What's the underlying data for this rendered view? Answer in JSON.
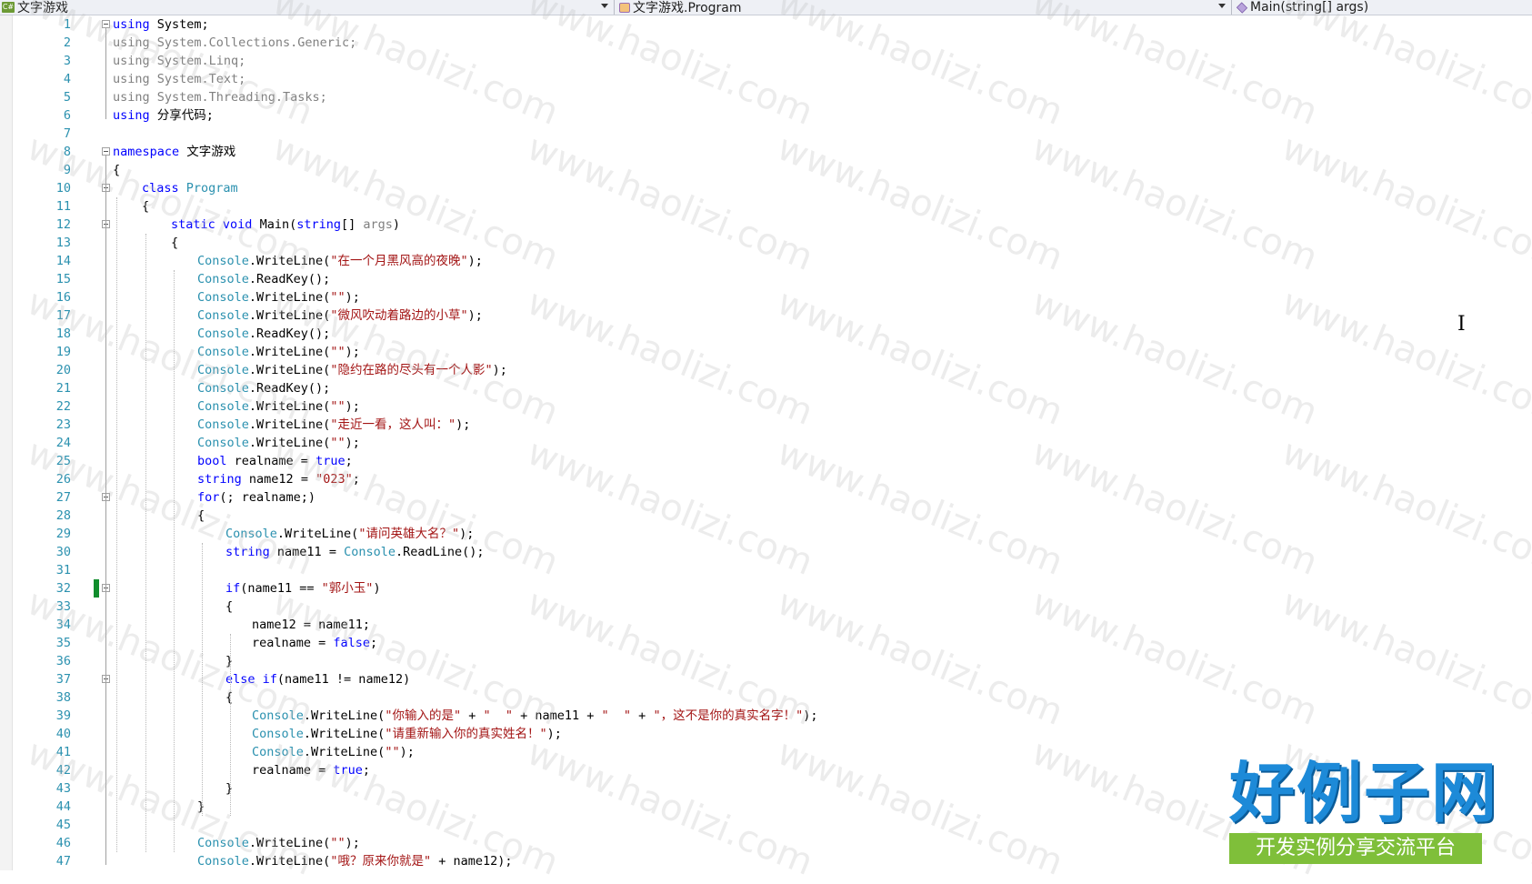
{
  "nav": {
    "project": "文字游戏",
    "type": "文字游戏.Program",
    "member": "Main(string[] args)"
  },
  "watermark": "www.haolizi.com",
  "logo": {
    "title": "好例子网",
    "subtitle": "开发实例分享交流平台"
  },
  "code_lines": [
    {
      "n": "1",
      "indent": 0,
      "tokens": [
        [
          "kw",
          "using"
        ],
        [
          "",
          "System;"
        ]
      ]
    },
    {
      "n": "2",
      "indent": 0,
      "tokens": [
        [
          "gray",
          "using"
        ],
        [
          "gray",
          "System.Collections.Generic;"
        ]
      ]
    },
    {
      "n": "3",
      "indent": 0,
      "tokens": [
        [
          "gray",
          "using"
        ],
        [
          "gray",
          "System.Linq;"
        ]
      ]
    },
    {
      "n": "4",
      "indent": 0,
      "tokens": [
        [
          "gray",
          "using"
        ],
        [
          "gray",
          "System.Text;"
        ]
      ]
    },
    {
      "n": "5",
      "indent": 0,
      "tokens": [
        [
          "gray",
          "using"
        ],
        [
          "gray",
          "System.Threading.Tasks;"
        ]
      ]
    },
    {
      "n": "6",
      "indent": 0,
      "tokens": [
        [
          "kw",
          "using"
        ],
        [
          "",
          "分享代码;"
        ]
      ]
    },
    {
      "n": "7",
      "indent": 0,
      "tokens": []
    },
    {
      "n": "8",
      "indent": 0,
      "tokens": [
        [
          "kw",
          "namespace"
        ],
        [
          "",
          "文字游戏"
        ]
      ]
    },
    {
      "n": "9",
      "indent": 0,
      "tokens": [
        [
          "",
          "{"
        ]
      ]
    },
    {
      "n": "10",
      "indent": 1,
      "tokens": [
        [
          "kw",
          "class"
        ],
        [
          "tp",
          "Program"
        ]
      ]
    },
    {
      "n": "11",
      "indent": 1,
      "tokens": [
        [
          "",
          "{"
        ]
      ]
    },
    {
      "n": "12",
      "indent": 2,
      "tokens": [
        [
          "kw",
          "static"
        ],
        [
          "kw",
          "void"
        ],
        [
          "",
          "Main("
        ],
        [
          "kw",
          "string"
        ],
        [
          "",
          "[] "
        ],
        [
          "gray",
          "args"
        ],
        [
          "",
          ")"
        ]
      ]
    },
    {
      "n": "13",
      "indent": 2,
      "tokens": [
        [
          "",
          "{"
        ]
      ]
    },
    {
      "n": "14",
      "indent": 3,
      "tokens": [
        [
          "tp",
          "Console"
        ],
        [
          "",
          ".WriteLine("
        ],
        [
          "str",
          "\"在一个月黑风高的夜晚\""
        ],
        [
          "",
          ");"
        ]
      ]
    },
    {
      "n": "15",
      "indent": 3,
      "tokens": [
        [
          "tp",
          "Console"
        ],
        [
          "",
          ".ReadKey();"
        ]
      ]
    },
    {
      "n": "16",
      "indent": 3,
      "tokens": [
        [
          "tp",
          "Console"
        ],
        [
          "",
          ".WriteLine("
        ],
        [
          "str",
          "\"\""
        ],
        [
          "",
          ");"
        ]
      ]
    },
    {
      "n": "17",
      "indent": 3,
      "tokens": [
        [
          "tp",
          "Console"
        ],
        [
          "",
          ".WriteLine("
        ],
        [
          "str",
          "\"微风吹动着路边的小草\""
        ],
        [
          "",
          ");"
        ]
      ]
    },
    {
      "n": "18",
      "indent": 3,
      "tokens": [
        [
          "tp",
          "Console"
        ],
        [
          "",
          ".ReadKey();"
        ]
      ]
    },
    {
      "n": "19",
      "indent": 3,
      "tokens": [
        [
          "tp",
          "Console"
        ],
        [
          "",
          ".WriteLine("
        ],
        [
          "str",
          "\"\""
        ],
        [
          "",
          ");"
        ]
      ]
    },
    {
      "n": "20",
      "indent": 3,
      "tokens": [
        [
          "tp",
          "Console"
        ],
        [
          "",
          ".WriteLine("
        ],
        [
          "str",
          "\"隐约在路的尽头有一个人影\""
        ],
        [
          "",
          ");"
        ]
      ]
    },
    {
      "n": "21",
      "indent": 3,
      "tokens": [
        [
          "tp",
          "Console"
        ],
        [
          "",
          ".ReadKey();"
        ]
      ]
    },
    {
      "n": "22",
      "indent": 3,
      "tokens": [
        [
          "tp",
          "Console"
        ],
        [
          "",
          ".WriteLine("
        ],
        [
          "str",
          "\"\""
        ],
        [
          "",
          ");"
        ]
      ]
    },
    {
      "n": "23",
      "indent": 3,
      "tokens": [
        [
          "tp",
          "Console"
        ],
        [
          "",
          ".WriteLine("
        ],
        [
          "str",
          "\"走近一看，这人叫：\""
        ],
        [
          "",
          ");"
        ]
      ]
    },
    {
      "n": "24",
      "indent": 3,
      "tokens": [
        [
          "tp",
          "Console"
        ],
        [
          "",
          ".WriteLine("
        ],
        [
          "str",
          "\"\""
        ],
        [
          "",
          ");"
        ]
      ]
    },
    {
      "n": "25",
      "indent": 3,
      "tokens": [
        [
          "kw",
          "bool"
        ],
        [
          "",
          "realname = "
        ],
        [
          "kw",
          "true"
        ],
        [
          "",
          ";"
        ]
      ]
    },
    {
      "n": "26",
      "indent": 3,
      "tokens": [
        [
          "kw",
          "string"
        ],
        [
          "",
          "name12 = "
        ],
        [
          "str",
          "\"023\""
        ],
        [
          "",
          ";"
        ]
      ]
    },
    {
      "n": "27",
      "indent": 3,
      "tokens": [
        [
          "kw",
          "for"
        ],
        [
          "",
          "(; realname;)"
        ]
      ]
    },
    {
      "n": "28",
      "indent": 3,
      "tokens": [
        [
          "",
          "{"
        ]
      ]
    },
    {
      "n": "29",
      "indent": 4,
      "tokens": [
        [
          "tp",
          "Console"
        ],
        [
          "",
          ".WriteLine("
        ],
        [
          "str",
          "\"请问英雄大名？\""
        ],
        [
          "",
          ");"
        ]
      ]
    },
    {
      "n": "30",
      "indent": 4,
      "tokens": [
        [
          "kw",
          "string"
        ],
        [
          "",
          "name11 = "
        ],
        [
          "tp",
          "Console"
        ],
        [
          "",
          ".ReadLine();"
        ]
      ]
    },
    {
      "n": "31",
      "indent": 4,
      "tokens": []
    },
    {
      "n": "32",
      "indent": 4,
      "tokens": [
        [
          "kw",
          "if"
        ],
        [
          "",
          "(name11 == "
        ],
        [
          "str",
          "\"郭小玉\""
        ],
        [
          "",
          ")"
        ]
      ]
    },
    {
      "n": "33",
      "indent": 4,
      "tokens": [
        [
          "",
          "{"
        ]
      ]
    },
    {
      "n": "34",
      "indent": 5,
      "tokens": [
        [
          "",
          "name12 = name11;"
        ]
      ]
    },
    {
      "n": "35",
      "indent": 5,
      "tokens": [
        [
          "",
          "realname = "
        ],
        [
          "kw",
          "false"
        ],
        [
          "",
          ";"
        ]
      ]
    },
    {
      "n": "36",
      "indent": 4,
      "tokens": [
        [
          "",
          "}"
        ]
      ]
    },
    {
      "n": "37",
      "indent": 4,
      "tokens": [
        [
          "kw",
          "else if"
        ],
        [
          "",
          "(name11 != name12)"
        ]
      ]
    },
    {
      "n": "38",
      "indent": 4,
      "tokens": [
        [
          "",
          "{"
        ]
      ]
    },
    {
      "n": "39",
      "indent": 5,
      "tokens": [
        [
          "tp",
          "Console"
        ],
        [
          "",
          ".WriteLine("
        ],
        [
          "str",
          "\"你输入的是\""
        ],
        [
          "",
          " + "
        ],
        [
          "str",
          "\"  \""
        ],
        [
          "",
          " + name11 + "
        ],
        [
          "str",
          "\"  \""
        ],
        [
          "",
          " + "
        ],
        [
          "str",
          "\"，这不是你的真实名字！\""
        ],
        [
          "",
          ");"
        ]
      ]
    },
    {
      "n": "40",
      "indent": 5,
      "tokens": [
        [
          "tp",
          "Console"
        ],
        [
          "",
          ".WriteLine("
        ],
        [
          "str",
          "\"请重新输入你的真实姓名！\""
        ],
        [
          "",
          ");"
        ]
      ]
    },
    {
      "n": "41",
      "indent": 5,
      "tokens": [
        [
          "tp",
          "Console"
        ],
        [
          "",
          ".WriteLine("
        ],
        [
          "str",
          "\"\""
        ],
        [
          "",
          ");"
        ]
      ]
    },
    {
      "n": "42",
      "indent": 5,
      "tokens": [
        [
          "",
          "realname = "
        ],
        [
          "kw",
          "true"
        ],
        [
          "",
          ";"
        ]
      ]
    },
    {
      "n": "43",
      "indent": 4,
      "tokens": [
        [
          "",
          "}"
        ]
      ]
    },
    {
      "n": "44",
      "indent": 3,
      "tokens": [
        [
          "",
          "}"
        ]
      ]
    },
    {
      "n": "45",
      "indent": 3,
      "tokens": []
    },
    {
      "n": "46",
      "indent": 3,
      "tokens": [
        [
          "tp",
          "Console"
        ],
        [
          "",
          ".WriteLine("
        ],
        [
          "str",
          "\"\""
        ],
        [
          "",
          ");"
        ]
      ]
    },
    {
      "n": "47",
      "indent": 3,
      "tokens": [
        [
          "tp",
          "Console"
        ],
        [
          "",
          ".WriteLine("
        ],
        [
          "str",
          "\"哦？原来你就是\""
        ],
        [
          "",
          " + name12);"
        ]
      ]
    }
  ]
}
